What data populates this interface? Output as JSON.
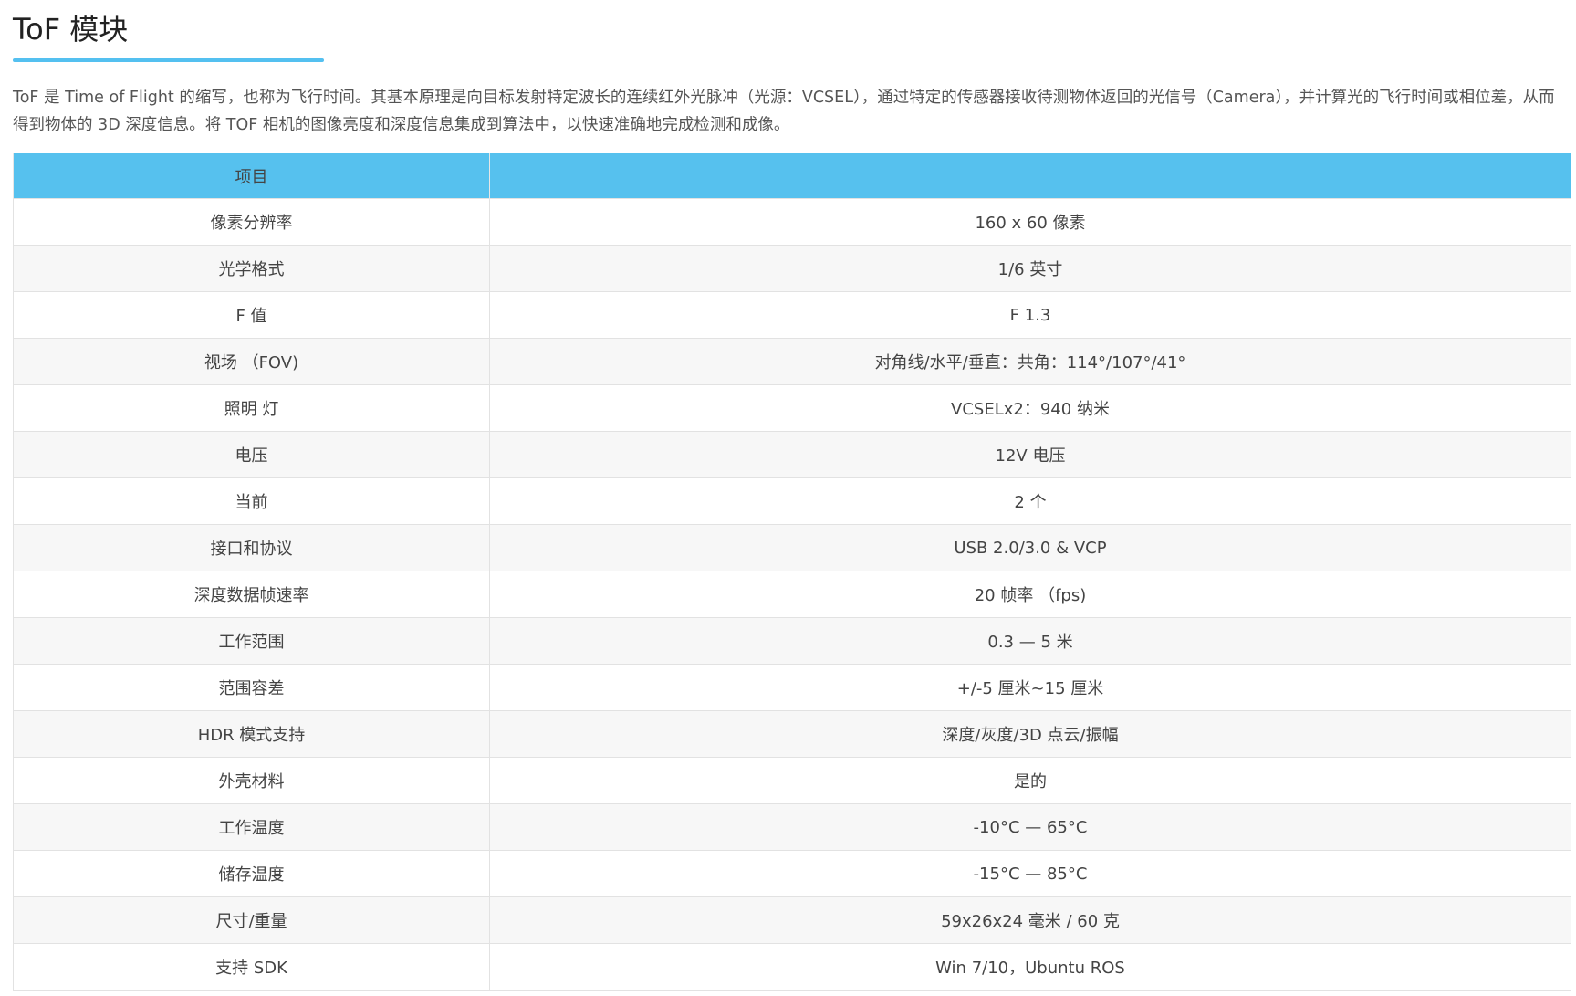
{
  "page": {
    "title": "ToF 模块",
    "intro": "ToF 是 Time of Flight 的缩写，也称为飞行时间。其基本原理是向目标发射特定波长的连续红外光脉冲（光源：VCSEL），通过特定的传感器接收待测物体返回的光信号（Camera），并计算光的飞行时间或相位差，从而得到物体的 3D 深度信息。将 TOF 相机的图像亮度和深度信息集成到算法中，以快速准确地完成检测和成像。",
    "accent_color": "#56c1ee"
  },
  "table": {
    "headers": [
      "项目",
      ""
    ],
    "rows": [
      [
        "像素分辨率",
        "160 x 60 像素"
      ],
      [
        "光学格式",
        "1/6 英寸"
      ],
      [
        "F 值",
        "F 1.3"
      ],
      [
        "视场 （FOV)",
        "对角线/水平/垂直：共角：114°/107°/41°"
      ],
      [
        "照明 灯",
        "VCSELx2：940 纳米"
      ],
      [
        "电压",
        "12V 电压"
      ],
      [
        "当前",
        "2 个"
      ],
      [
        "接口和协议",
        "USB 2.0/3.0 & VCP"
      ],
      [
        "深度数据帧速率",
        "20 帧率 （fps)"
      ],
      [
        "工作范围",
        "0.3 — 5 米"
      ],
      [
        "范围容差",
        "+/-5 厘米~15 厘米"
      ],
      [
        "HDR 模式支持",
        "深度/灰度/3D 点云/振幅"
      ],
      [
        "外壳材料",
        "是的"
      ],
      [
        "工作温度",
        "-10°C — 65°C"
      ],
      [
        "储存温度",
        "-15°C — 85°C"
      ],
      [
        "尺寸/重量",
        "59x26x24 毫米 / 60 克"
      ],
      [
        "支持 SDK",
        "Win 7/10，Ubuntu ROS"
      ]
    ]
  }
}
